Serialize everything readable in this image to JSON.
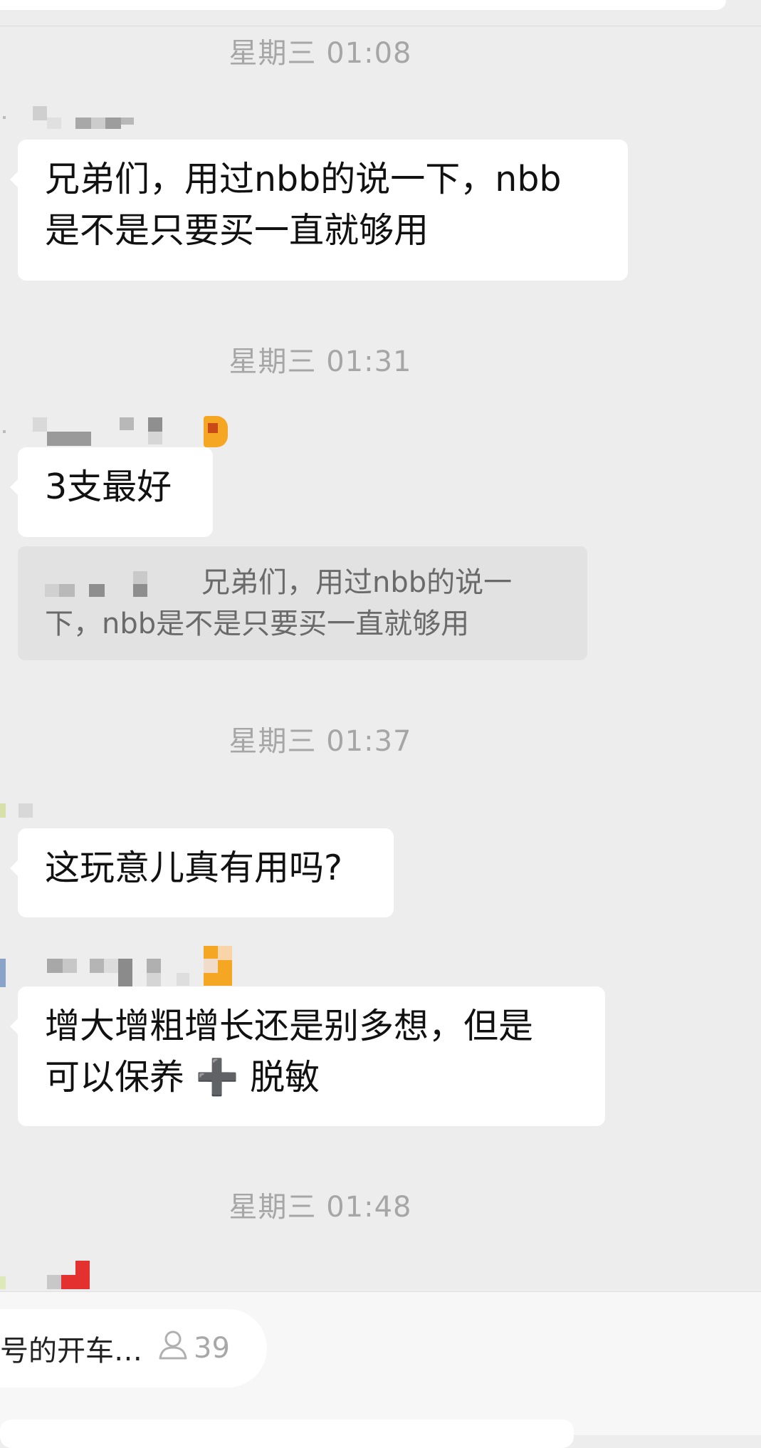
{
  "timestamps": [
    "星期三 01:08",
    "星期三 01:31",
    "星期三 01:37",
    "星期三 01:48"
  ],
  "messages": [
    {
      "text_line1": "兄弟们，用过nbb的说一下，nbb",
      "text_line2": "是不是只要买一直就够用"
    },
    {
      "text_line1": "3支最好"
    },
    {
      "text_line1": "这玩意儿真有用吗?"
    },
    {
      "text_line1": "增大增粗增长还是别多想，但是",
      "text_line2": "可以保养 ➕ 脱敏"
    }
  ],
  "quote": {
    "text_line1": "兄弟们，用过nbb的说一",
    "text_line2": "下，nbb是不是只要买一直就够用"
  },
  "group": {
    "title": "号的开车…",
    "member_count": "39",
    "member_icon": "person-icon"
  },
  "colors": {
    "background": "#ededed",
    "bubble": "#ffffff",
    "quote_bg": "#e2e2e2",
    "timestamp": "#a6a6a6"
  }
}
